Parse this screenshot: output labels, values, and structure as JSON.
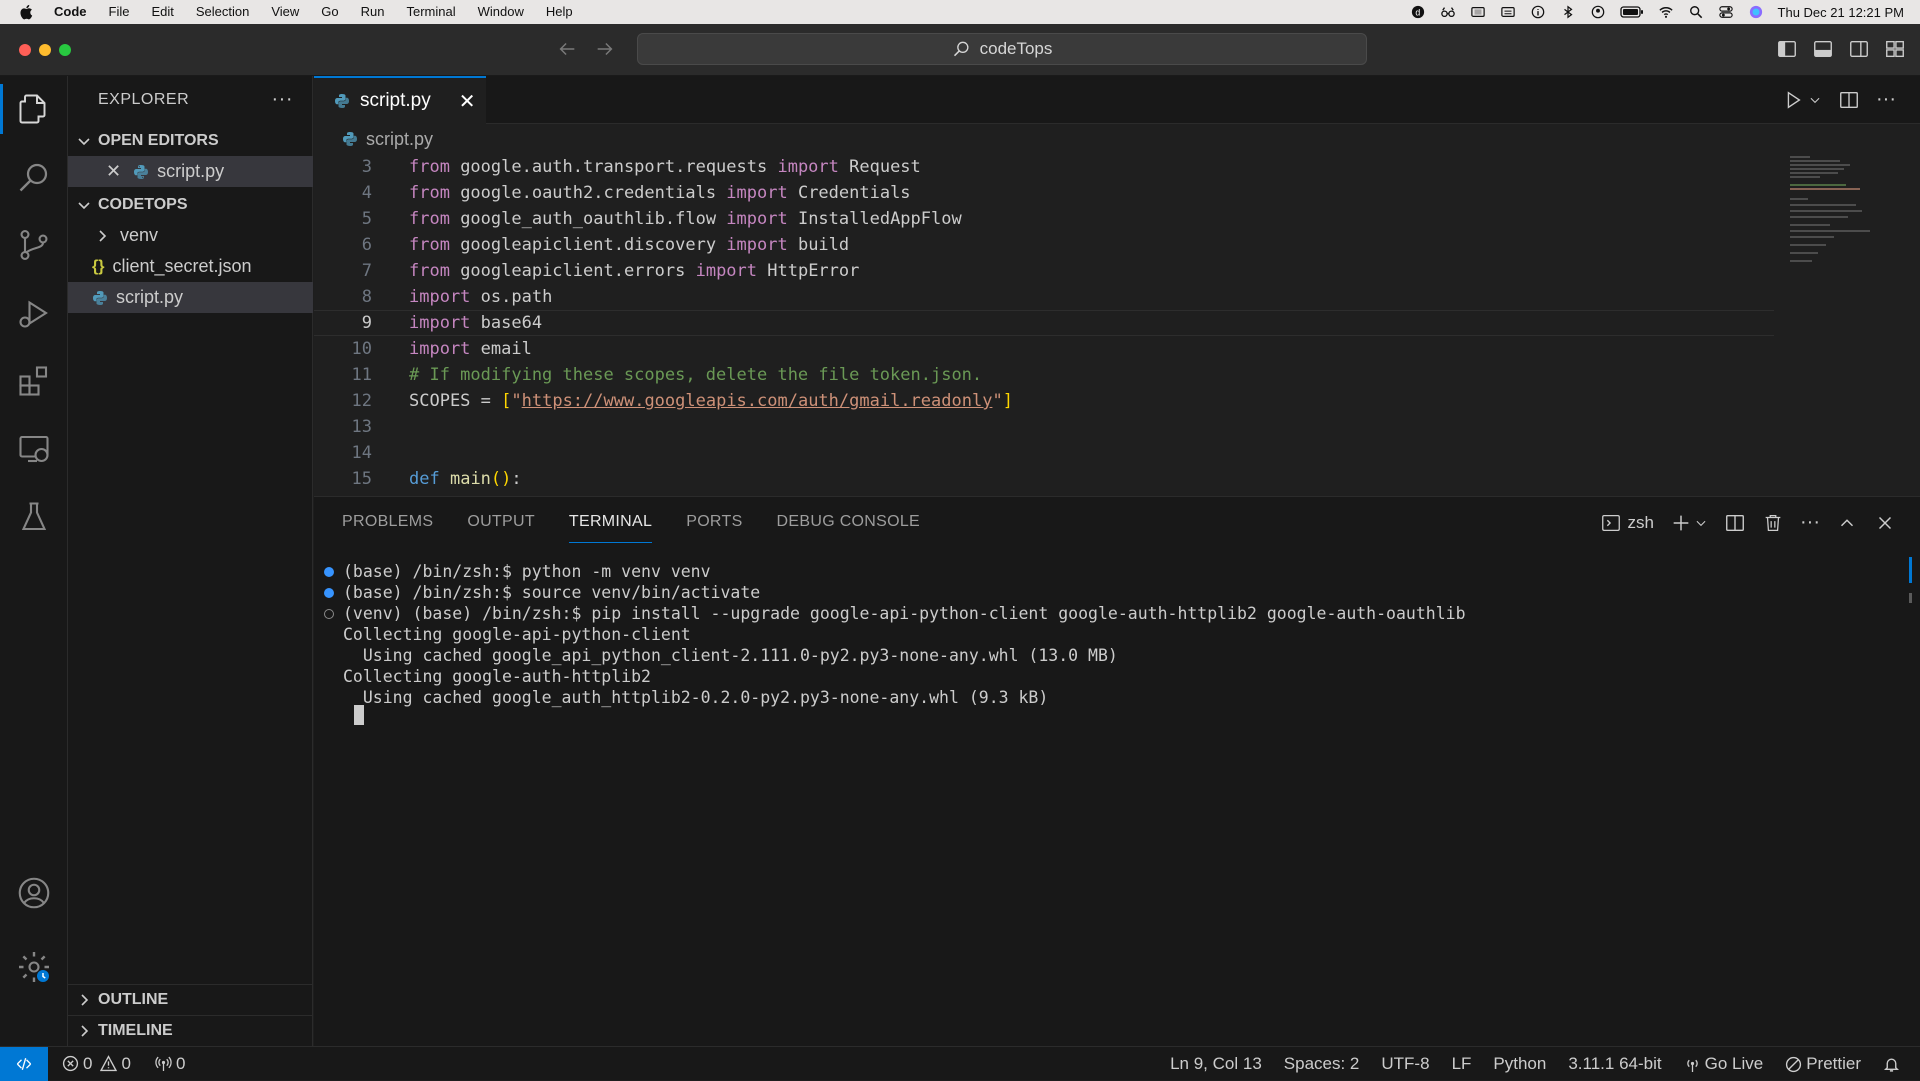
{
  "menubar": {
    "app": "Code",
    "items": [
      "File",
      "Edit",
      "Selection",
      "View",
      "Go",
      "Run",
      "Terminal",
      "Window",
      "Help"
    ],
    "clock": "Thu Dec 21  12:21 PM"
  },
  "titlebar": {
    "search": "codeTops"
  },
  "sidebar": {
    "title": "EXPLORER",
    "open_editors_label": "OPEN EDITORS",
    "open_editor_file": "script.py",
    "folder_label": "CODETOPS",
    "tree": [
      {
        "name": "venv",
        "type": "folder"
      },
      {
        "name": "client_secret.json",
        "type": "json"
      },
      {
        "name": "script.py",
        "type": "python"
      }
    ],
    "outline_label": "OUTLINE",
    "timeline_label": "TIMELINE"
  },
  "editor": {
    "tab_label": "script.py",
    "breadcrumb": "script.py",
    "current_line": 9,
    "lines": [
      {
        "n": "3",
        "html": "<span class='kw'>from</span> google.auth.transport.requests <span class='kw'>import</span> Request"
      },
      {
        "n": "4",
        "html": "<span class='kw'>from</span> google.oauth2.credentials <span class='kw'>import</span> Credentials"
      },
      {
        "n": "5",
        "html": "<span class='kw'>from</span> google_auth_oauthlib.flow <span class='kw'>import</span> InstalledAppFlow"
      },
      {
        "n": "6",
        "html": "<span class='kw'>from</span> googleapiclient.discovery <span class='kw'>import</span> build"
      },
      {
        "n": "7",
        "html": "<span class='kw'>from</span> googleapiclient.errors <span class='kw'>import</span> HttpError"
      },
      {
        "n": "8",
        "html": "<span class='kw'>import</span> os.path"
      },
      {
        "n": "9",
        "html": "<span class='kw'>import</span> base64"
      },
      {
        "n": "10",
        "html": "<span class='kw'>import</span> email"
      },
      {
        "n": "11",
        "html": "<span class='cm'># If modifying these scopes, delete the file token.json.</span>"
      },
      {
        "n": "12",
        "html": "SCOPES = <span class='brk'>[</span><span class='str'>\"</span><span class='url'>https://www.googleapis.com/auth/gmail.readonly</span><span class='str'>\"</span><span class='brk'>]</span>"
      },
      {
        "n": "13",
        "html": ""
      },
      {
        "n": "14",
        "html": ""
      },
      {
        "n": "15",
        "html": "<span class='kwb'>def</span> <span class='fn'>main</span><span class='brk'>()</span>:"
      }
    ]
  },
  "panel": {
    "tabs": [
      "PROBLEMS",
      "OUTPUT",
      "TERMINAL",
      "PORTS",
      "DEBUG CONSOLE"
    ],
    "active_tab": "TERMINAL",
    "shell": "zsh",
    "terminal_lines": [
      {
        "dot": "blue",
        "text": "(base) /bin/zsh:$ python -m venv venv"
      },
      {
        "dot": "blue",
        "text": "(base) /bin/zsh:$ source venv/bin/activate"
      },
      {
        "dot": "empty",
        "text": "(venv) (base) /bin/zsh:$ pip install --upgrade google-api-python-client google-auth-httplib2 google-auth-oauthlib"
      },
      {
        "dot": "",
        "text": "Collecting google-api-python-client"
      },
      {
        "dot": "",
        "text": "  Using cached google_api_python_client-2.111.0-py2.py3-none-any.whl (13.0 MB)"
      },
      {
        "dot": "",
        "text": "Collecting google-auth-httplib2"
      },
      {
        "dot": "",
        "text": "  Using cached google_auth_httplib2-0.2.0-py2.py3-none-any.whl (9.3 kB)"
      }
    ]
  },
  "statusbar": {
    "errors": "0",
    "warnings": "0",
    "ports": "0",
    "position": "Ln 9, Col 13",
    "spaces": "Spaces: 2",
    "encoding": "UTF-8",
    "eol": "LF",
    "language": "Python",
    "interpreter": "3.11.1 64-bit",
    "go_live": "Go Live",
    "prettier": "Prettier"
  },
  "colors": {
    "accent": "#0078d4",
    "python": "#519aba",
    "json": "#cbcb41"
  }
}
